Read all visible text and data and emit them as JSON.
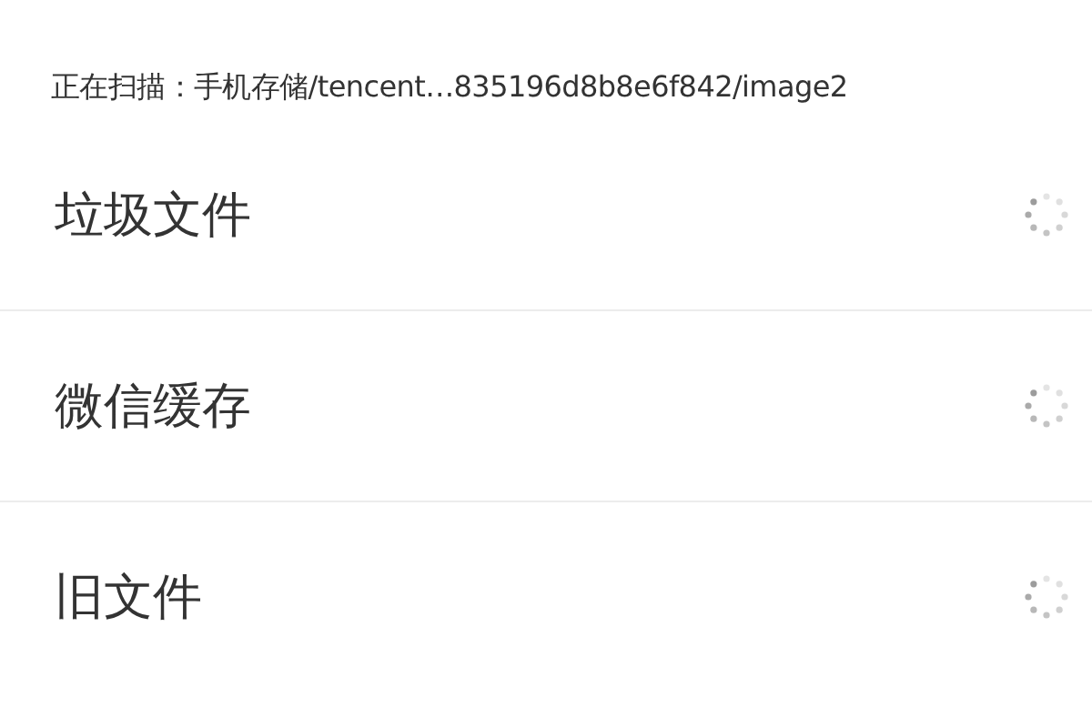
{
  "scan_status": {
    "text": "正在扫描：手机存储/tencent…835196d8b8e6f842/image2"
  },
  "items": [
    {
      "label": "垃圾文件",
      "kind": "loading"
    },
    {
      "label": "微信缓存",
      "kind": "loading"
    },
    {
      "label": "旧文件",
      "kind": "loading"
    }
  ]
}
